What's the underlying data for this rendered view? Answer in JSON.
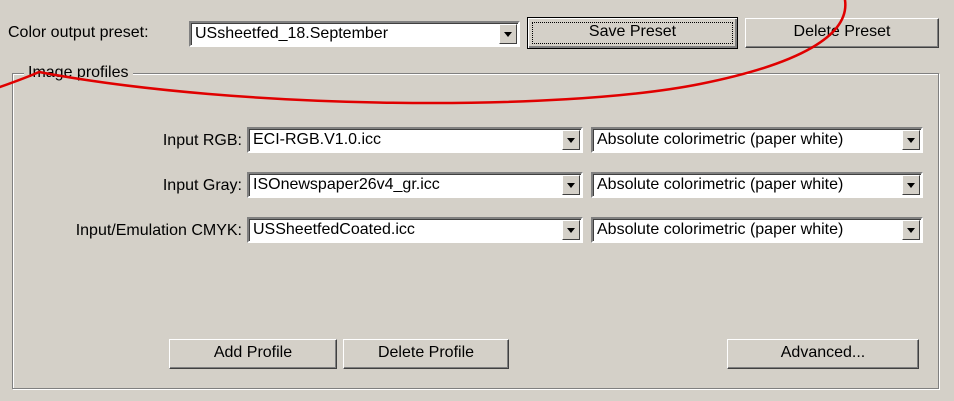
{
  "preset": {
    "label": "Color output preset:",
    "selected": "USsheetfed_18.September",
    "save_button": "Save Preset",
    "delete_button": "Delete Preset"
  },
  "image_profiles": {
    "group_title": "Image profiles",
    "rows": [
      {
        "label": "Input RGB:",
        "profile": "ECI-RGB.V1.0.icc",
        "intent": "Absolute colorimetric (paper white)"
      },
      {
        "label": "Input Gray:",
        "profile": "ISOnewspaper26v4_gr.icc",
        "intent": "Absolute colorimetric (paper white)"
      },
      {
        "label": "Input/Emulation CMYK:",
        "profile": "USSheetfedCoated.icc",
        "intent": "Absolute colorimetric (paper white)"
      }
    ],
    "add_button": "Add Profile",
    "delete_button": "Delete Profile",
    "advanced_button": "Advanced..."
  },
  "colors": {
    "dialog_face": "#d4d0c8",
    "annotation_stroke": "#e00000"
  },
  "annotation": {
    "shape": "red hand-drawn ellipse highlighting the Save Preset button"
  }
}
